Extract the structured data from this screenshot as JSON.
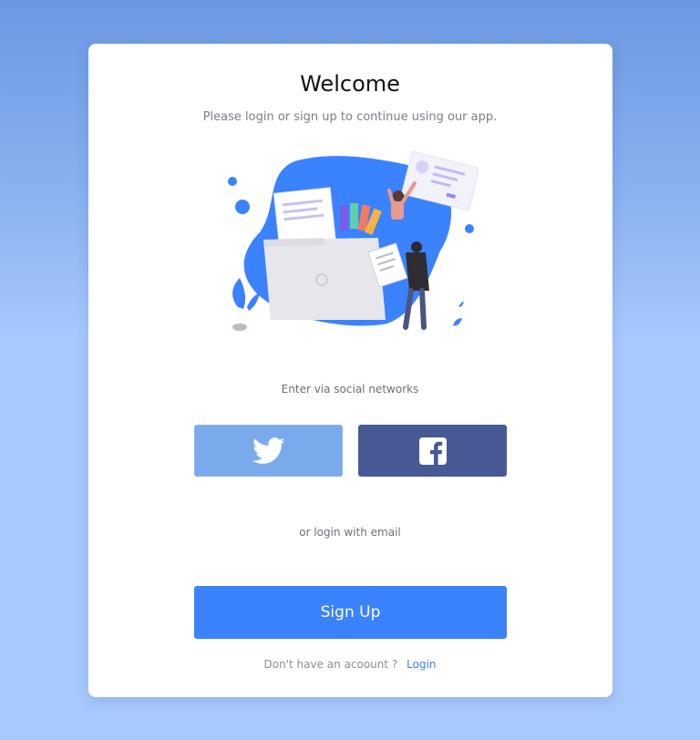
{
  "header": {
    "title": "Welcome",
    "subtitle": "Please login or sign up to continue using our app."
  },
  "illustration": {
    "name": "upload-files-illustration"
  },
  "social": {
    "label": "Enter via social networks",
    "twitter_icon": "twitter-icon",
    "facebook_icon": "facebook-icon"
  },
  "email": {
    "label": "or login with email"
  },
  "signup": {
    "label": "Sign Up"
  },
  "footer": {
    "prompt": "Don't have an acoount ?",
    "login_link": "Login"
  },
  "colors": {
    "accent": "#3b82ff",
    "twitter": "#7aaaec",
    "facebook": "#475a96",
    "background": "#a8c9fd"
  }
}
